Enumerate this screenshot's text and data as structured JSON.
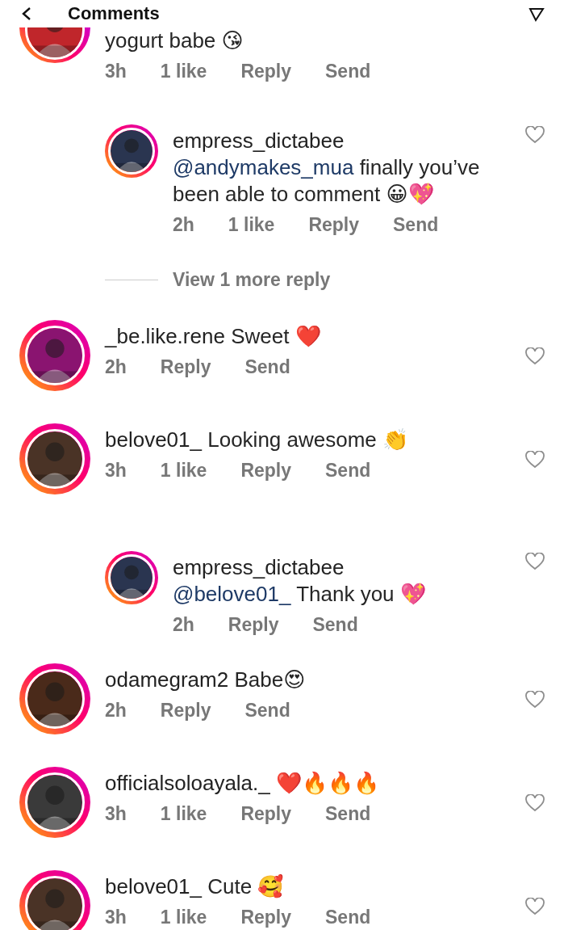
{
  "header": {
    "title": "Comments"
  },
  "items": [
    {
      "kind": "comment",
      "partial": true,
      "text": "yogurt babe 😘",
      "time": "3h",
      "likes": "1 like",
      "reply": "Reply",
      "send": "Send"
    },
    {
      "kind": "reply",
      "username": "empress_dictabee",
      "mention": "@andymakes_mua",
      "text": "finally you’ve been able to comment 😀💖",
      "time": "2h",
      "likes": "1 like",
      "reply": "Reply",
      "send": "Send"
    },
    {
      "kind": "more",
      "label": "View 1 more reply"
    },
    {
      "kind": "comment",
      "username": "_be.like.rene",
      "text": "Sweet ❤️",
      "time": "2h",
      "reply": "Reply",
      "send": "Send"
    },
    {
      "kind": "comment",
      "username": "belove01_",
      "text": "Looking awesome 👏",
      "time": "3h",
      "likes": "1 like",
      "reply": "Reply",
      "send": "Send"
    },
    {
      "kind": "reply",
      "username": "empress_dictabee",
      "mention": "@belove01_",
      "text": "Thank you 💖",
      "time": "2h",
      "reply": "Reply",
      "send": "Send"
    },
    {
      "kind": "comment",
      "username": "odamegram2",
      "text": "Babe😍",
      "time": "2h",
      "reply": "Reply",
      "send": "Send"
    },
    {
      "kind": "comment",
      "username": "officialsoloayala._",
      "text": "❤️🔥🔥🔥",
      "time": "3h",
      "likes": "1 like",
      "reply": "Reply",
      "send": "Send"
    },
    {
      "kind": "comment",
      "username": "belove01_",
      "text": "Cute 🥰",
      "time": "3h",
      "likes": "1 like",
      "reply": "Reply",
      "send": "Send"
    }
  ]
}
